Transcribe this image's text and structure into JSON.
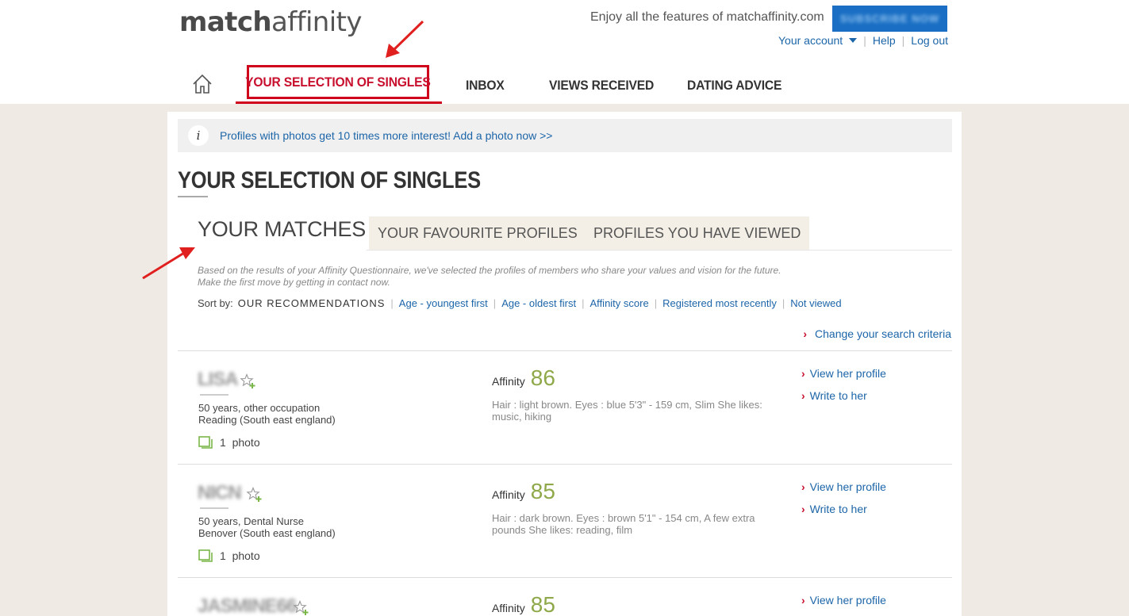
{
  "header": {
    "logo_bold": "match",
    "logo_light": "affinity",
    "promo": "Enjoy all the features of matchaffinity.com",
    "subscribe_label": "SUBSCRIBE NOW",
    "account_label": "Your account",
    "help_label": "Help",
    "logout_label": "Log out"
  },
  "nav": {
    "items": [
      {
        "label": "YOUR SELECTION OF SINGLES",
        "active": true
      },
      {
        "label": "INBOX"
      },
      {
        "label": "VIEWS RECEIVED"
      },
      {
        "label": "DATING ADVICE"
      }
    ]
  },
  "info": {
    "text": "Profiles with photos get 10 times more interest! Add a photo now >>"
  },
  "page_title": "YOUR SELECTION OF SINGLES",
  "tabs": [
    "YOUR MATCHES",
    "YOUR FAVOURITE PROFILES",
    "PROFILES YOU HAVE VIEWED"
  ],
  "intro": {
    "line1": "Based on the results of your Affinity Questionnaire, we've selected the profiles of members who share your values and vision for the future.",
    "line2": "Make the first move by getting in contact now."
  },
  "sort": {
    "label": "Sort by:",
    "current": "OUR RECOMMENDATIONS",
    "options": [
      "Age - youngest first",
      "Age - oldest first",
      "Affinity score",
      "Registered most recently",
      "Not viewed"
    ]
  },
  "change_criteria": "Change your search criteria",
  "matches": [
    {
      "name": "LISA",
      "age_occupation": "50 years, other occupation",
      "location": "Reading (South east england)",
      "photo_count": "1",
      "photo_label": "photo",
      "affinity_label": "Affinity",
      "score": "86",
      "description": "Hair : light brown. Eyes : blue 5'3\" - 159 cm, Slim She likes: music, hiking",
      "view_label": "View her profile",
      "write_label": "Write to her"
    },
    {
      "name": "NICN",
      "age_occupation": "50 years, Dental Nurse",
      "location": "Benover (South east england)",
      "photo_count": "1",
      "photo_label": "photo",
      "affinity_label": "Affinity",
      "score": "85",
      "description": "Hair : dark brown. Eyes : brown 5'1\" - 154 cm, A few extra pounds She likes: reading, film",
      "view_label": "View her profile",
      "write_label": "Write to her"
    },
    {
      "name": "JASMINE66",
      "affinity_label": "Affinity",
      "score": "85",
      "view_label": "View her profile"
    }
  ],
  "colors": {
    "accent_red": "#d0021b",
    "link_blue": "#1c65a8",
    "score_green": "#8fa94a",
    "page_bg": "#efebe4"
  }
}
